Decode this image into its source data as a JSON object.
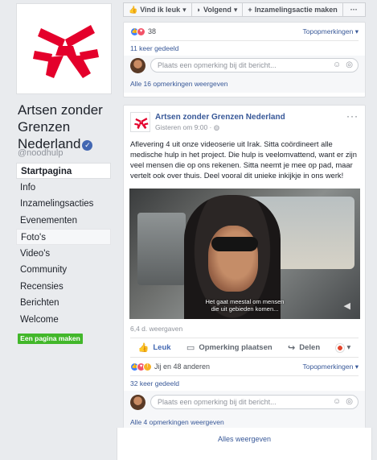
{
  "page": {
    "name": "Artsen zonder Grenzen Nederland",
    "name_lines": [
      "Artsen zonder",
      "Grenzen",
      "Nederland"
    ],
    "handle": "@noodhulp",
    "create_button": "Een pagina maken",
    "brand_color": "#e4002b"
  },
  "sidebar": {
    "items": [
      {
        "label": "Startpagina",
        "state": "active"
      },
      {
        "label": "Info"
      },
      {
        "label": "Inzamelingsacties"
      },
      {
        "label": "Evenementen"
      },
      {
        "label": "Foto's",
        "state": "highlight"
      },
      {
        "label": "Video's"
      },
      {
        "label": "Community"
      },
      {
        "label": "Recensies"
      },
      {
        "label": "Berichten"
      },
      {
        "label": "Welcome"
      }
    ]
  },
  "topbar": {
    "like_label": "Vind ik leuk",
    "follow_label": "Volgend",
    "fundraiser_label": "Inzamelingsactie maken",
    "more_label": "···"
  },
  "post1": {
    "reaction_count": "38",
    "top_comments": "Topopmerkingen",
    "shared": "11 keer gedeeld",
    "comment_placeholder": "Plaats een opmerking bij dit bericht...",
    "all_comments": "Alle 16 opmerkingen weergeven"
  },
  "post2": {
    "author": "Artsen zonder Grenzen Nederland",
    "time": "Gisteren om 9:00 · ",
    "text": "Aflevering 4 uit onze videoserie uit Irak. Sitta coördineert alle medische hulp in het project. Die hulp is veelomvattend, want er zijn veel mensen die op ons rekenen. Sitta neemt je mee op pad, maar vertelt ook over thuis. Deel vooral dit unieke inkijkje in ons werk!",
    "subtitle_line1": "Het gaat meestal om mensen",
    "subtitle_line2": "die uit gebieden komen...",
    "views": "6,4 d. weergaven",
    "like_label": "Leuk",
    "comment_label": "Opmerking plaatsen",
    "share_label": "Delen",
    "reactions_text": "Jij en 48 anderen",
    "top_comments": "Topopmerkingen",
    "shared": "32 keer gedeeld",
    "comment_placeholder": "Plaats een opmerking bij dit bericht...",
    "all_comments": "Alle 4 opmerkingen weergeven"
  },
  "footer": {
    "show_all": "Alles weergeven"
  }
}
